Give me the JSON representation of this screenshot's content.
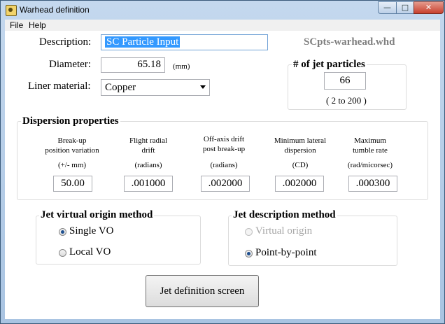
{
  "window": {
    "title": "Warhead definition",
    "min_glyph": "—",
    "max_glyph": "□",
    "close_glyph": "✕"
  },
  "menu": {
    "file": "File",
    "help": "Help"
  },
  "form": {
    "description_label": "Description:",
    "description_value": "SC Particle Input",
    "file_name": "SCpts-warhead.whd",
    "diameter_label": "Diameter:",
    "diameter_value": "65.18",
    "diameter_unit": "(mm)",
    "liner_label": "Liner material:",
    "liner_value": "Copper"
  },
  "jet_particles": {
    "title": "# of jet particles",
    "value": "66",
    "range": "( 2 to 200 )"
  },
  "dispersion": {
    "title": "Dispersion properties",
    "columns": [
      {
        "line1": "Break-up",
        "line2": "position variation",
        "unit": "(+/- mm)",
        "value": "50.00"
      },
      {
        "line1": "Flight radial",
        "line2": "drift",
        "unit": "(radians)",
        "value": ".001000"
      },
      {
        "line1": "Off-axis drift",
        "line2": "post break-up",
        "unit": "(radians)",
        "value": ".002000"
      },
      {
        "line1": "Minimum lateral",
        "line2": "dispersion",
        "unit": "(CD)",
        "value": ".002000"
      },
      {
        "line1": "Maximum",
        "line2": "tumble rate",
        "unit": "(rad/micorsec)",
        "value": ".000300"
      }
    ]
  },
  "vo_method": {
    "title": "Jet virtual origin method",
    "options": [
      {
        "label": "Single VO",
        "selected": true
      },
      {
        "label": "Local VO",
        "selected": false
      }
    ]
  },
  "desc_method": {
    "title": "Jet description method",
    "options": [
      {
        "label": "Virtual origin",
        "selected": false,
        "disabled": true
      },
      {
        "label": "Point-by-point",
        "selected": true,
        "disabled": false
      }
    ]
  },
  "buttons": {
    "jet_definition": "Jet definition screen"
  }
}
